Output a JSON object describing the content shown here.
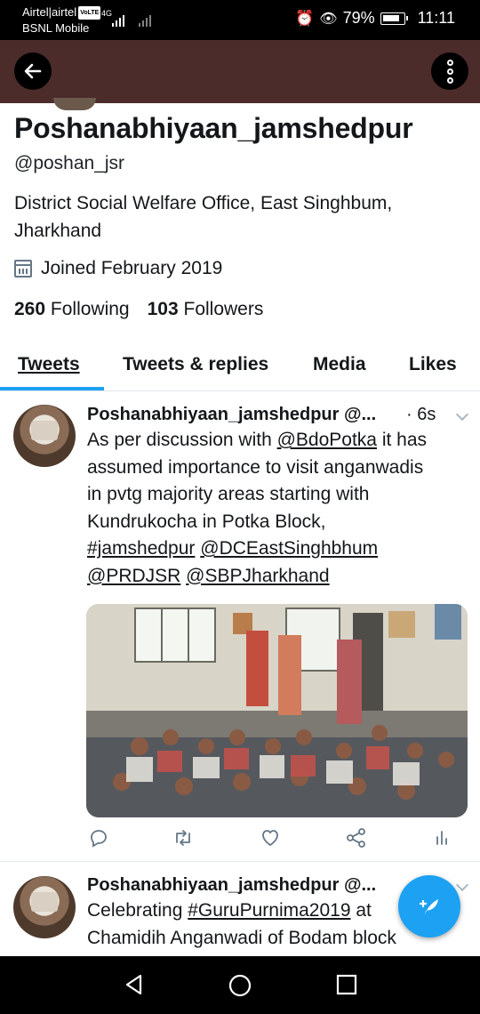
{
  "status_bar": {
    "carrier_line1": "Airtel|airtel",
    "volte": "VoLTE",
    "network": "4G",
    "carrier_line2": "BSNL Mobile",
    "battery": "79%",
    "time": "11:11"
  },
  "profile": {
    "name": "Poshanabhiyaan_jamshedpur",
    "handle": "@poshan_jsr",
    "bio_line1": "District Social Welfare Office, East Singhbum,",
    "bio_line2": "Jharkhand",
    "joined": "Joined February 2019",
    "following_count": "260",
    "following_label": "Following",
    "followers_count": "103",
    "followers_label": "Followers"
  },
  "tabs": [
    {
      "label": "Tweets"
    },
    {
      "label": "Tweets & replies"
    },
    {
      "label": "Media"
    },
    {
      "label": "Likes"
    }
  ],
  "tweets": [
    {
      "name": "Poshanabhiyaan_jamshedpur",
      "handle": "@...",
      "time": "· 6s",
      "line1_a": "As per discussion with ",
      "line1_mention": "@BdoPotka",
      "line1_b": " it has",
      "line2": "assumed importance to visit anganwadis",
      "line3": "in pvtg majority areas starting with",
      "line4": "Kundrukocha in Potka Block,",
      "tag1": "#jamshedpur",
      "tag2": "@DCEastSinghbhum",
      "tag3": "@PRDJSR",
      "tag4": "@SBPJharkhand"
    },
    {
      "name": "Poshanabhiyaan_jamshedpur",
      "handle": "@...",
      "line1_a": "Celebrating ",
      "line1_tag": "#GuruPurnima2019",
      "line1_b": " at",
      "line2": "Chamidih Anganwadi of Bodam block"
    }
  ],
  "colors": {
    "header_bg": "#4b2c2b",
    "accent": "#1da1f2",
    "icon_gray": "#657786"
  }
}
